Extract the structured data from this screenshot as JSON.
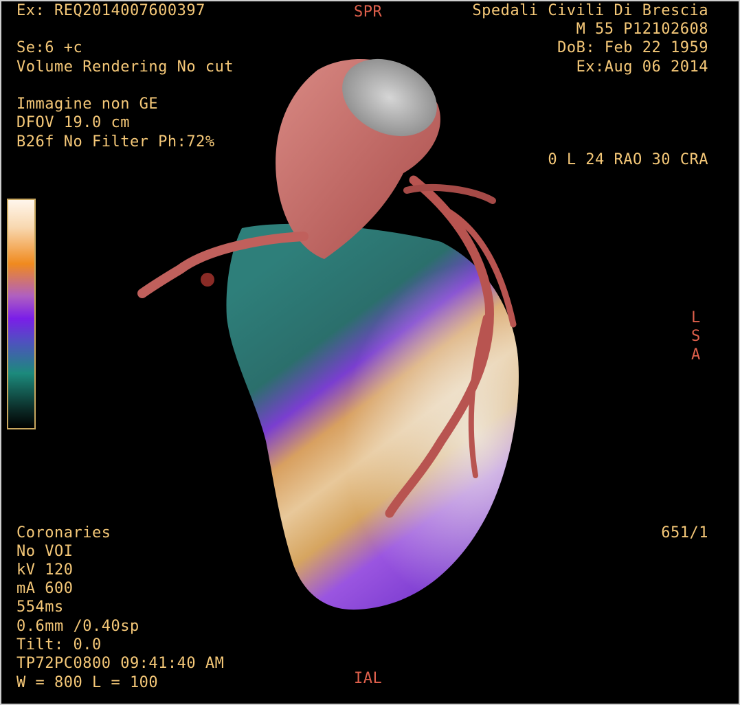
{
  "header_left": {
    "exam": "Ex: REQ2014007600397",
    "series": "Se:6 +c",
    "render_mode": "Volume Rendering No cut",
    "image_note": "Immagine non GE",
    "dfov": "DFOV 19.0 cm",
    "filter": "B26f No Filter Ph:72%"
  },
  "header_right": {
    "institution": "Spedali Civili Di Brescia",
    "patient": "M 55 P12102608",
    "dob": "DoB: Feb 22 1959",
    "exam_date": "Ex:Aug 06 2014",
    "view_angle": "0 L 24 RAO 30 CRA"
  },
  "orientation": {
    "top": "SPR",
    "right_1": "L",
    "right_2": "S",
    "right_3": "A",
    "bottom": "IAL"
  },
  "footer_left": {
    "preset": "Coronaries",
    "voi": "No VOI",
    "kv": "kV 120",
    "ma": "mA 600",
    "time": "554ms",
    "slice": "0.6mm /0.40sp",
    "tilt": "Tilt: 0.0",
    "timestamp": "TP72PC0800 09:41:40 AM",
    "window": "W = 800 L = 100"
  },
  "footer_right": {
    "image_index": "651/1"
  },
  "colors": {
    "overlay_text": "#f5c878",
    "orientation_text": "#e0604c",
    "background": "#000000"
  },
  "icons": {
    "color_scale": "color-scale-bar"
  }
}
